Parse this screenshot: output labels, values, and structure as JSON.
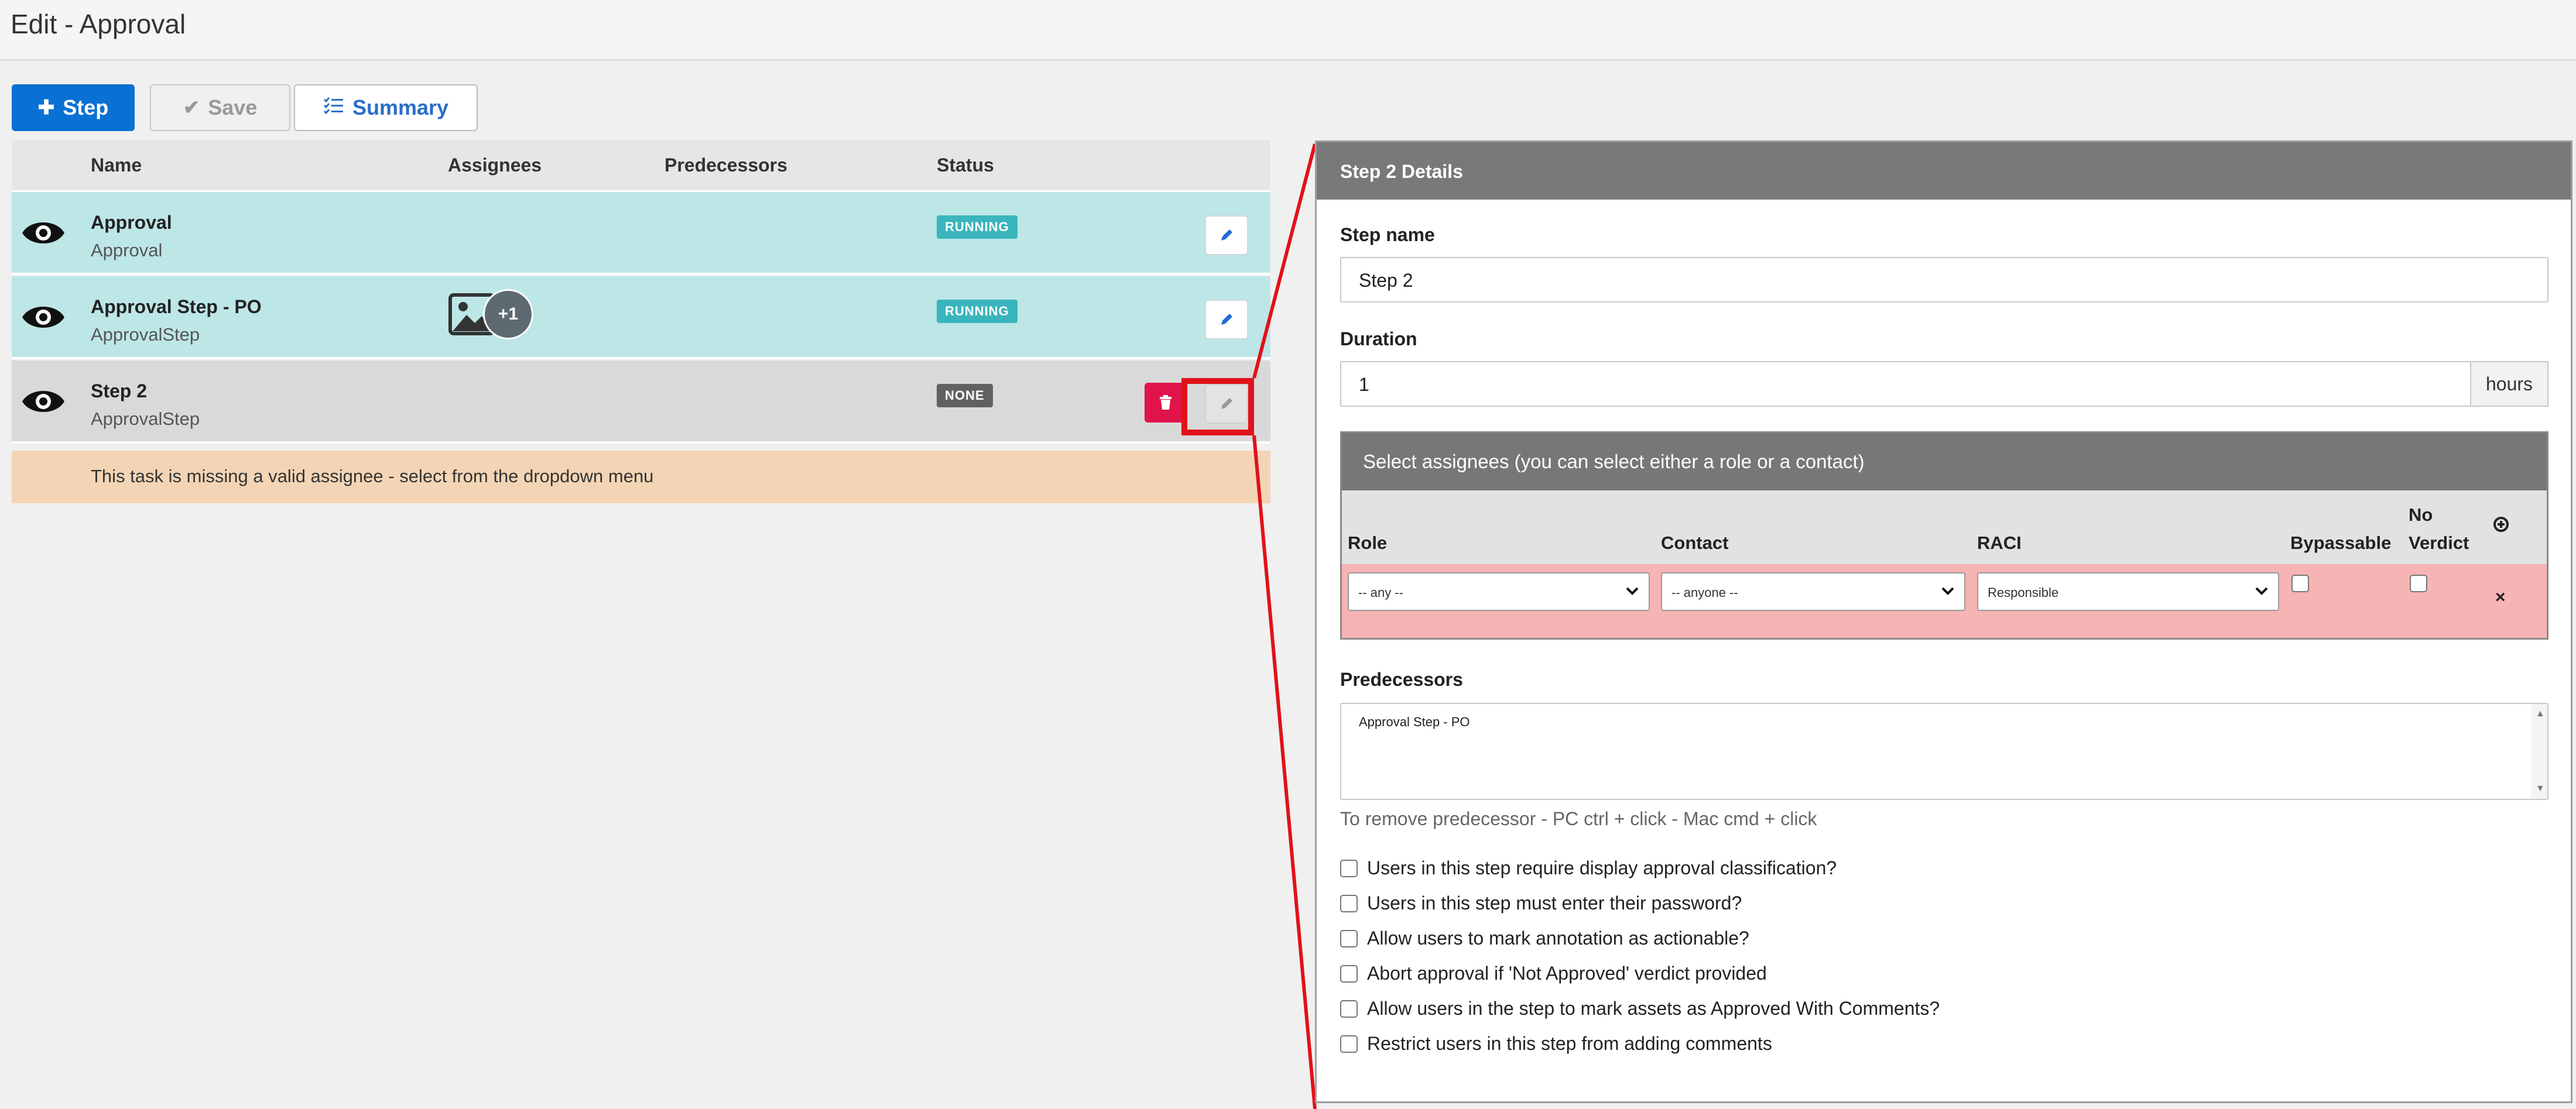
{
  "header": {
    "title": "Edit - Approval"
  },
  "toolbar": {
    "step_label": "Step",
    "save_label": "Save",
    "summary_label": "Summary"
  },
  "table": {
    "columns": [
      "Name",
      "Assignees",
      "Predecessors",
      "Status"
    ],
    "rows": [
      {
        "name": "Approval",
        "type": "Approval",
        "status": "RUNNING"
      },
      {
        "name": "Approval Step - PO",
        "type": "ApprovalStep",
        "status": "RUNNING",
        "assignee_extra": "+1"
      },
      {
        "name": "Step 2",
        "type": "ApprovalStep",
        "status": "NONE"
      }
    ],
    "warning": "This task is missing a valid assignee - select from the dropdown menu"
  },
  "panel": {
    "title": "Step 2 Details",
    "step_name_label": "Step name",
    "step_name_value": "Step 2",
    "duration_label": "Duration",
    "duration_value": "1",
    "duration_unit": "hours",
    "assignees": {
      "title": "Select assignees (you can select either a role or a contact)",
      "col_role": "Role",
      "col_contact": "Contact",
      "col_raci": "RACI",
      "col_bypassable": "Bypassable",
      "col_noverdict_1": "No",
      "col_noverdict_2": "Verdict",
      "role_value": "-- any --",
      "contact_value": "-- anyone --",
      "raci_value": "Responsible",
      "remove_label": "×"
    },
    "predecessors_label": "Predecessors",
    "predecessors_option": "Approval Step - PO",
    "predecessors_hint": "To remove predecessor - PC ctrl + click - Mac cmd + click",
    "options": [
      "Users in this step require display approval classification?",
      "Users in this step must enter their password?",
      "Allow users to mark annotation as actionable?",
      "Abort approval if 'Not Approved' verdict provided",
      "Allow users in the step to mark assets as Approved With Comments?",
      "Restrict users in this step from adding comments"
    ]
  },
  "colors": {
    "primary": "#0a71d4",
    "running": "#3bb5bc",
    "none": "#616161",
    "danger": "#e0144b",
    "highlight": "#e1111a",
    "row_active": "#bde6e7",
    "row_selected": "#d9d9d9",
    "warning_bg": "#f3d5b5",
    "error_row": "#f7b4b4"
  }
}
